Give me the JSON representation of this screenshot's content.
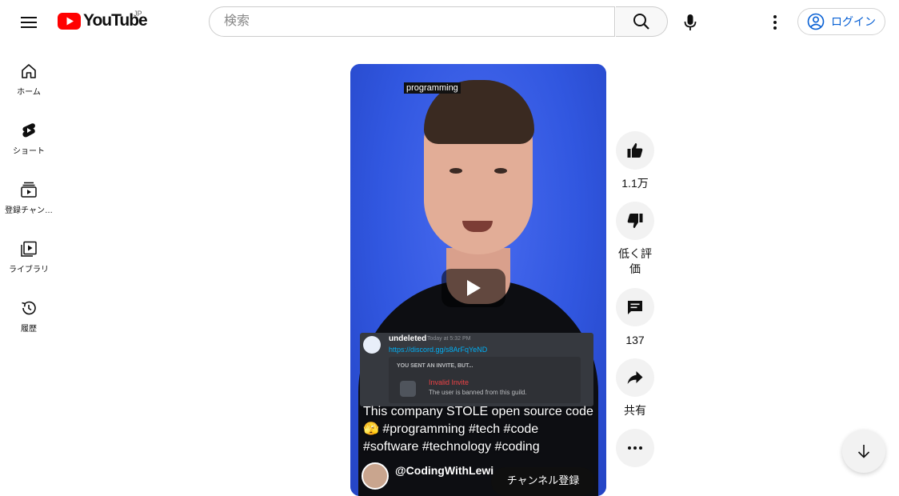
{
  "header": {
    "logo_text": "YouTube",
    "region": "JP",
    "search_placeholder": "検索",
    "login_label": "ログイン"
  },
  "sidebar": {
    "items": [
      {
        "label": "ホーム",
        "icon": "home-icon"
      },
      {
        "label": "ショート",
        "icon": "shorts-icon"
      },
      {
        "label": "登録チャン…",
        "icon": "subscriptions-icon"
      },
      {
        "label": "ライブラリ",
        "icon": "library-icon"
      },
      {
        "label": "履歴",
        "icon": "history-icon"
      }
    ]
  },
  "short": {
    "topic_tag": "programming",
    "caption": "This company STOLE open source code 🫣 #programming #tech #code #software #technology #coding",
    "channel": "@CodingWithLewi",
    "subscribe_label": "チャンネル登録",
    "discord": {
      "user": "undeleted",
      "time": "Today at 5:32 PM",
      "link": "https://discord.gg/s8ArFqYeND",
      "invite_heading": "YOU SENT AN INVITE, BUT...",
      "invalid": "Invalid Invite",
      "banned": "The user is banned from this guild."
    }
  },
  "actions": {
    "like_count": "1.1万",
    "dislike_label": "低く評価",
    "comment_count": "137",
    "share_label": "共有"
  },
  "colors": {
    "brand_red": "#ff0000",
    "link_blue": "#065fd4",
    "video_bg": "#3157e0"
  }
}
